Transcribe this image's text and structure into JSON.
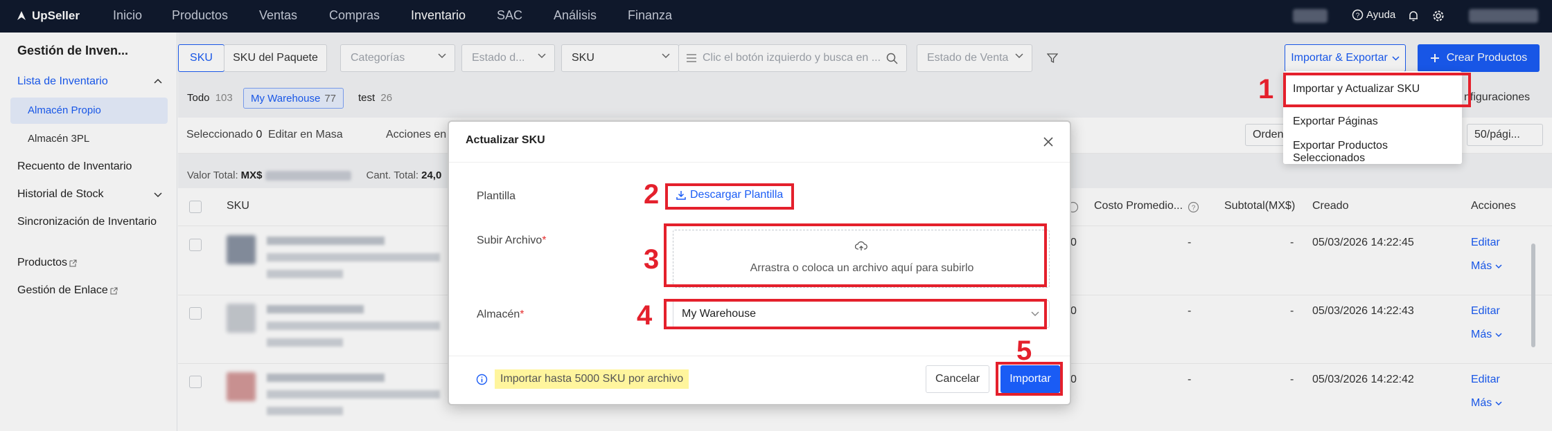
{
  "nav": {
    "logo": "UpSeller",
    "items": [
      {
        "label": "Inicio"
      },
      {
        "label": "Productos"
      },
      {
        "label": "Ventas"
      },
      {
        "label": "Compras"
      },
      {
        "label": "Inventario"
      },
      {
        "label": "SAC"
      },
      {
        "label": "Análisis"
      },
      {
        "label": "Finanza"
      }
    ],
    "help": "Ayuda"
  },
  "sidebar": {
    "title": "Gestión de Inven...",
    "inventory_list": "Lista de Inventario",
    "own_warehouse": "Almacén Propio",
    "warehouse_3pl": "Almacén 3PL",
    "recount": "Recuento de Inventario",
    "stock_history": "Historial de Stock",
    "sync": "Sincronización de Inventario",
    "products": "Productos",
    "link_mgmt": "Gestión de Enlace"
  },
  "filters": {
    "tab_sku": "SKU",
    "tab_package": "SKU del Paquete",
    "categories": "Categorías",
    "state": "Estado d...",
    "sku_select": "SKU",
    "search_placeholder": "Clic el botón izquierdo y busca en ...",
    "sale_state": "Estado de Venta"
  },
  "actions": {
    "import_export": "Importar & Exportar",
    "create": "Crear Productos"
  },
  "warehouse_tabs": [
    {
      "label": "Todo",
      "count": "103"
    },
    {
      "label": "My Warehouse",
      "count": "77"
    },
    {
      "label": "test",
      "count": "26"
    }
  ],
  "config": "nfiguraciones",
  "toolbar": {
    "selected_label": "Seleccionado",
    "selected_count": "0",
    "bulk_edit": "Editar en Masa",
    "actions": "Acciones en",
    "order": "Orden",
    "per_page": "50/pági..."
  },
  "totals": {
    "value_label": "Valor Total:",
    "currency": "MX$",
    "qty_label": "Cant. Total:",
    "qty": "24,0"
  },
  "table": {
    "headers": {
      "sku": "SKU",
      "avg_cost": "Costo Promedio...",
      "subtotal": "Subtotal(MX$)",
      "created": "Creado",
      "actions": "Acciones"
    },
    "rows": [
      {
        "avg": "-",
        "sub": "-",
        "created": "05/03/2026 14:22:45",
        "edit": "Editar",
        "more": "Más",
        "c0": "0"
      },
      {
        "avg": "-",
        "sub": "-",
        "created": "05/03/2026 14:22:43",
        "edit": "Editar",
        "more": "Más",
        "c0": "0"
      },
      {
        "avg": "-",
        "sub": "-",
        "created": "05/03/2026 14:22:42",
        "edit": "Editar",
        "more": "Más",
        "c0": "0"
      }
    ]
  },
  "dropdown": {
    "items": [
      {
        "label": "Importar y Actualizar SKU"
      },
      {
        "label": "Exportar Páginas"
      },
      {
        "label": "Exportar Productos Seleccionados"
      }
    ]
  },
  "modal": {
    "title": "Actualizar SKU",
    "template_label": "Plantilla",
    "download": "Descargar Plantilla",
    "upload_label": "Subir Archivo",
    "upload_hint": "Arrastra o coloca un archivo aquí para subirlo",
    "warehouse_label": "Almacén",
    "warehouse_value": "My Warehouse",
    "note": "Importar hasta 5000 SKU por archivo",
    "cancel": "Cancelar",
    "import": "Importar"
  },
  "steps": [
    "1",
    "2",
    "3",
    "4",
    "5"
  ],
  "colors": {
    "primary": "#1a5cf5",
    "nav": "#101a2e",
    "highlight_red": "#e4202c",
    "note_bg": "#fff59d"
  }
}
